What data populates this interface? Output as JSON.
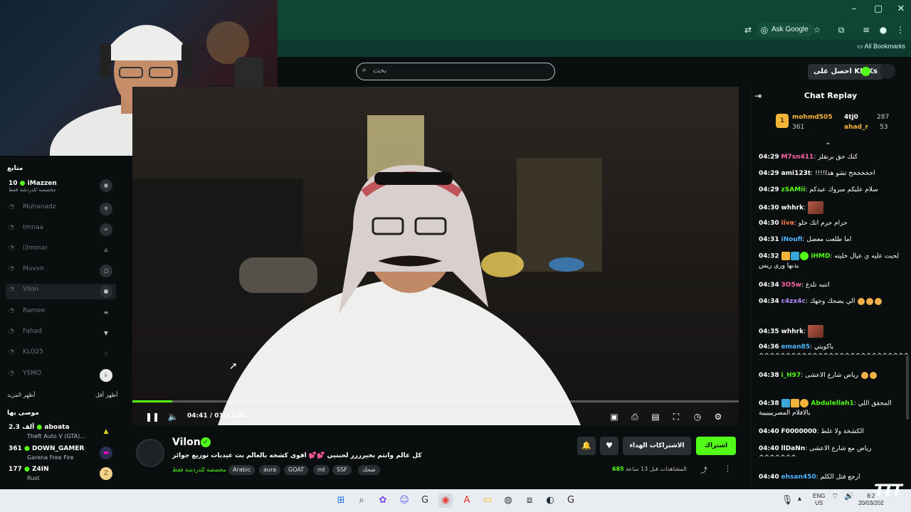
{
  "browser": {
    "ask_google": "Ask Google",
    "all_bookmarks": "All Bookmarks",
    "window_controls": [
      "–",
      "▢",
      "✕"
    ]
  },
  "site": {
    "search_placeholder": "بحث",
    "kicks_button": "احصل على KICKs"
  },
  "sidebar": {
    "following_title": "متابع",
    "channels": [
      {
        "name": "iMazzen",
        "count": "10",
        "sub": "مخصصة للدردشة فقط",
        "live": true
      },
      {
        "name": "Muhanadz",
        "live": false
      },
      {
        "name": "tmnaa",
        "live": false
      },
      {
        "name": "i3mmar",
        "live": false
      },
      {
        "name": "Muvxn",
        "live": false
      },
      {
        "name": "Vilon",
        "live": false,
        "active": true
      },
      {
        "name": "Ramee",
        "live": false
      },
      {
        "name": "Fahad",
        "live": false
      },
      {
        "name": "KLO25",
        "live": false
      },
      {
        "name": "YSMO",
        "live": false
      }
    ],
    "show_more": "أظهر المزيد",
    "show_less": "أظهر أقل",
    "recommended_title": "موصى بها",
    "recommended": [
      {
        "name": "aboata",
        "count": "2.3 ألف",
        "game": "Theft Auto V (GTA)..."
      },
      {
        "name": "DOWN_GAMER",
        "count": "361",
        "game": "Garena Free Fire"
      },
      {
        "name": "Z4IN",
        "count": "177",
        "game": "Rust"
      }
    ]
  },
  "player": {
    "current_time": "04:41",
    "separator": "/",
    "duration": "01:11:02",
    "progress": 0.066
  },
  "stream": {
    "channel_name": "Vilon",
    "title": "كل عالم وانتم بخيرررر لحبتيي 💕💕 اقوى كشخه بالعالم بث عيديات توزيع جوائز",
    "category": "مخصصة للدردشة فقط",
    "tags": [
      "Arabic",
      "aura",
      "GOAT",
      "mt",
      "SSF",
      "ضحك"
    ],
    "viewers_count": "685",
    "viewers_label": "المشاهدات",
    "ago": "قبل 13 ساعة",
    "subscribe": "اشتراك",
    "gift_subs": "الاشتراكات الهداء"
  },
  "chat": {
    "header": "Chat Replay",
    "top_gifters": [
      {
        "name": "mohmd505",
        "value": "361"
      },
      {
        "name": "4tj0",
        "value": "287"
      },
      {
        "name": "ahad_r",
        "value": "53"
      }
    ],
    "messages": [
      {
        "time": "04:29",
        "user": "M7sn411",
        "color": "#ff66aa",
        "text": "كنك حق برنقلز"
      },
      {
        "time": "04:29",
        "user": "ami123t",
        "color": "#ffffff",
        "text": "!!!!اخخخخخخ تشو هذا"
      },
      {
        "time": "04:29",
        "user": "zSAMii",
        "color": "#53fc18",
        "text": "سلام عليكم مبروك عيدكم"
      },
      {
        "time": "04:30",
        "user": "whhrk",
        "color": "#ffffff",
        "text": "",
        "emote": true
      },
      {
        "time": "04:30",
        "user": "iiva",
        "color": "#ff7a45",
        "text": "حرام حرم انك حلو"
      },
      {
        "time": "04:31",
        "user": "iNoufi",
        "color": "#4ab4ff",
        "text": "اما طلعت معضل"
      },
      {
        "time": "04:32",
        "user": "iHMD",
        "color": "#53fc18",
        "text": "لحبت عليه ي عيال خليته يذبها ورى ريس"
      },
      {
        "time": "04:34",
        "user": "3O5w",
        "color": "#ff66aa",
        "text": "اتنبه تلدغ"
      },
      {
        "time": "04:34",
        "user": "c4zx4c",
        "color": "#b38bff",
        "text": "الي يضحك وجهك"
      },
      {
        "time": "04:35",
        "user": "whhrk",
        "color": "#ffffff",
        "text": "",
        "emote": true
      },
      {
        "time": "04:36",
        "user": "eman85",
        "color": "#4ab4ff",
        "text": "ياكويتي ^^^^^^^^^^^^^^^^^^^^^^^^^^^^"
      },
      {
        "time": "04:38",
        "user": "i_H97",
        "color": "#53fc18",
        "text": "رياض شارع الاعشى"
      },
      {
        "time": "04:38",
        "user": "Abdulellah1",
        "color": "#53fc18",
        "text": "المحقق اللي بالافلام المصريييييية"
      },
      {
        "time": "04:40",
        "user": "F0000000",
        "color": "#ffffff",
        "text": "الكشخة ولا غلط"
      },
      {
        "time": "04:40",
        "user": "llDaNn",
        "color": "#ffffff",
        "text": "رياض مع شارع الاعشى ^^^^^^^"
      },
      {
        "time": "04:40",
        "user": "ehsan450",
        "color": "#4ab4ff",
        "text": "ارجع فتل الكلم"
      }
    ]
  },
  "taskbar": {
    "lang": "ENG",
    "region": "US",
    "time": "8:2",
    "date": "20/03/202"
  },
  "watermark": "TTT"
}
